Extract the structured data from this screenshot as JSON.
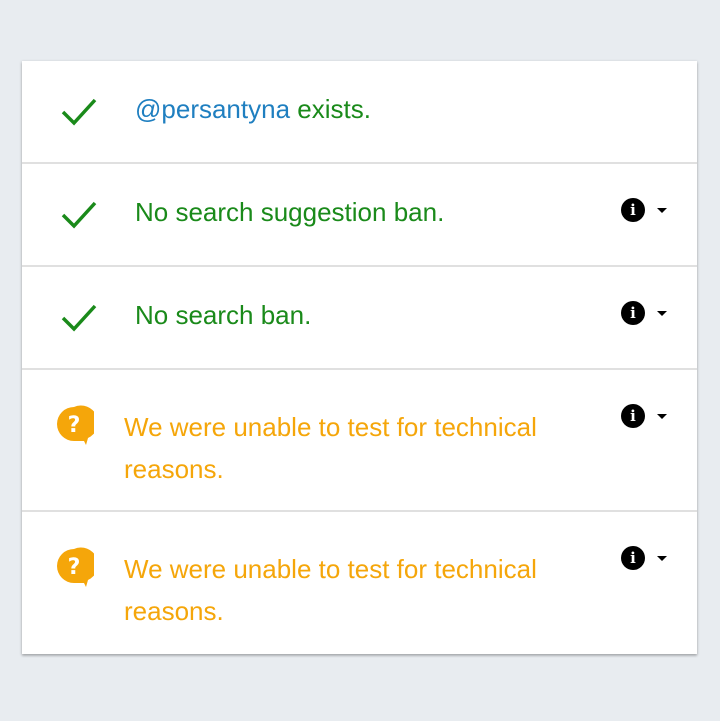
{
  "results": [
    {
      "status": "ok",
      "icon": "checkmark-icon",
      "handle": "@persantyna",
      "text": " exists.",
      "has_info": false
    },
    {
      "status": "ok",
      "icon": "checkmark-icon",
      "text": "No search suggestion ban.",
      "has_info": true
    },
    {
      "status": "ok",
      "icon": "checkmark-icon",
      "text": "No search ban.",
      "has_info": true
    },
    {
      "status": "unknown",
      "icon": "question-bubble-icon",
      "text": "We were unable to test for technical reasons.",
      "has_info": true
    },
    {
      "status": "unknown",
      "icon": "question-bubble-icon",
      "text": "We were unable to test for technical reasons.",
      "has_info": true
    }
  ],
  "colors": {
    "ok": "#1a8a1a",
    "warn": "#f5a60a",
    "handle": "#1f7fc0",
    "background": "#e8ecf0"
  },
  "info_glyph": "i"
}
